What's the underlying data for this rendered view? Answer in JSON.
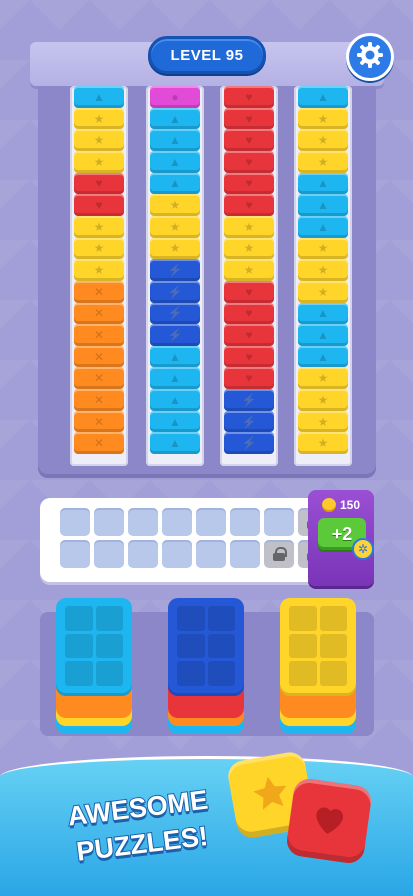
{
  "header": {
    "level_label": "LEVEL 95"
  },
  "icons": {
    "settings": "gear-icon",
    "lock": "lock-icon",
    "coin": "coin-icon",
    "wheel": "wheel-icon",
    "star": "star-icon",
    "heart": "heart-icon",
    "drop": "drop-icon",
    "bolt": "bolt-icon",
    "triangle": "triangle-icon",
    "cross": "cross-icon",
    "flower": "flower-icon"
  },
  "colors": {
    "yellow": "#ffd52a",
    "red": "#e8353b",
    "orange": "#ff8a1f",
    "cyan": "#1eb6f0",
    "blue": "#2458d6",
    "magenta": "#e24ad8",
    "accent": "#1f69d8",
    "booster": "#8a3ec8",
    "green": "#5cc93a"
  },
  "tubes": [
    [
      "orange",
      "orange",
      "orange",
      "orange",
      "orange",
      "orange",
      "orange",
      "orange",
      "yellow",
      "yellow",
      "yellow",
      "red",
      "red",
      "yellow",
      "yellow",
      "yellow",
      "cyan"
    ],
    [
      "cyan",
      "cyan",
      "cyan",
      "cyan",
      "cyan",
      "blue",
      "blue",
      "blue",
      "blue",
      "yellow",
      "yellow",
      "yellow",
      "cyan",
      "cyan",
      "cyan",
      "cyan",
      "magenta"
    ],
    [
      "blue",
      "blue",
      "blue",
      "red",
      "red",
      "red",
      "red",
      "red",
      "yellow",
      "yellow",
      "yellow",
      "red",
      "red",
      "red",
      "red",
      "red",
      "red"
    ],
    [
      "yellow",
      "yellow",
      "yellow",
      "yellow",
      "cyan",
      "cyan",
      "cyan",
      "yellow",
      "yellow",
      "yellow",
      "cyan",
      "cyan",
      "cyan",
      "yellow",
      "yellow",
      "yellow",
      "cyan"
    ]
  ],
  "tray": {
    "locked_count": 3
  },
  "booster": {
    "price": "150",
    "label": "+2"
  },
  "stacks": [
    {
      "top": "cyan",
      "layers": [
        "orange",
        "yellow",
        "cyan"
      ]
    },
    {
      "top": "blue",
      "layers": [
        "red",
        "orange",
        "cyan"
      ]
    },
    {
      "top": "yellow",
      "layers": [
        "orange",
        "yellow",
        "cyan"
      ]
    }
  ],
  "promo": {
    "line1": "AWESOME",
    "line2": "PUZZLES!"
  }
}
